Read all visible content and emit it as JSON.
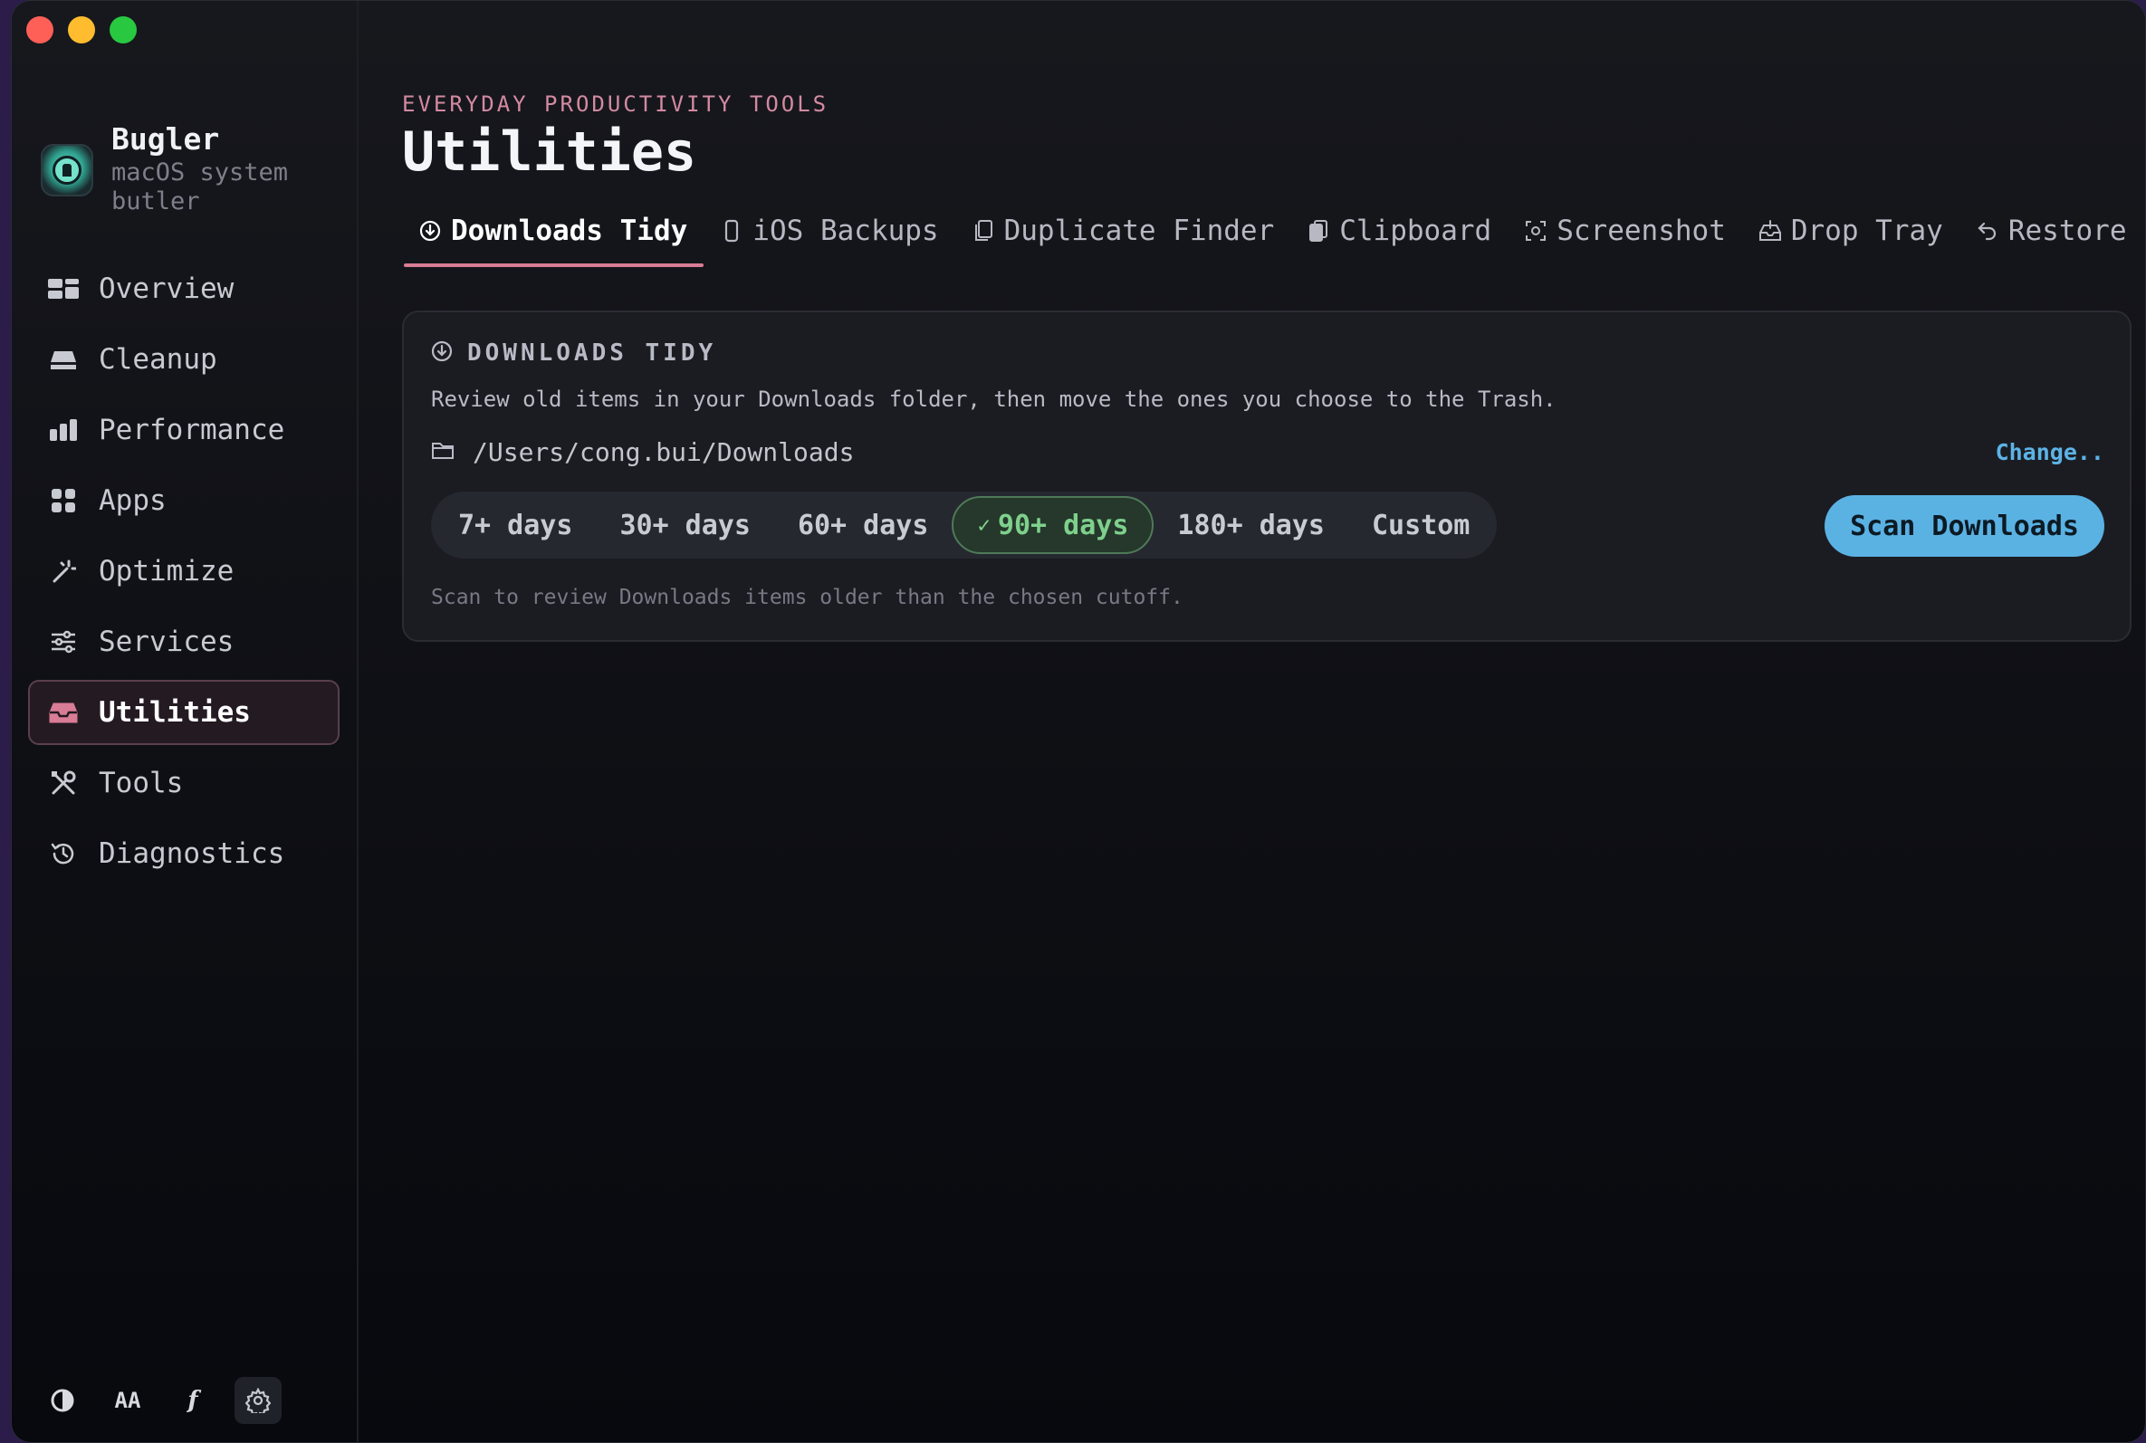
{
  "app": {
    "name": "Bugler",
    "subtitle": "macOS system butler"
  },
  "sidebar": {
    "items": [
      {
        "label": "Overview",
        "icon": "overview-icon",
        "active": false
      },
      {
        "label": "Cleanup",
        "icon": "cleanup-icon",
        "active": false
      },
      {
        "label": "Performance",
        "icon": "performance-icon",
        "active": false
      },
      {
        "label": "Apps",
        "icon": "apps-icon",
        "active": false
      },
      {
        "label": "Optimize",
        "icon": "optimize-icon",
        "active": false
      },
      {
        "label": "Services",
        "icon": "services-icon",
        "active": false
      },
      {
        "label": "Utilities",
        "icon": "utilities-icon",
        "active": true
      },
      {
        "label": "Tools",
        "icon": "tools-icon",
        "active": false
      },
      {
        "label": "Diagnostics",
        "icon": "diagnostics-icon",
        "active": false
      }
    ],
    "bottom": {
      "theme_icon": "contrast-icon",
      "font_size_label": "AA",
      "font_label": "f",
      "settings_icon": "gear-icon"
    }
  },
  "header": {
    "eyebrow": "EVERYDAY PRODUCTIVITY TOOLS",
    "title": "Utilities"
  },
  "tabs": [
    {
      "label": "Downloads Tidy",
      "icon": "download-circle-icon",
      "active": true
    },
    {
      "label": "iOS Backups",
      "icon": "phone-icon",
      "active": false
    },
    {
      "label": "Duplicate Finder",
      "icon": "duplicate-icon",
      "active": false
    },
    {
      "label": "Clipboard",
      "icon": "clipboard-icon",
      "active": false
    },
    {
      "label": "Screenshot",
      "icon": "screenshot-icon",
      "active": false
    },
    {
      "label": "Drop Tray",
      "icon": "tray-icon",
      "active": false
    },
    {
      "label": "Restore Center",
      "icon": "undo-icon",
      "active": false
    }
  ],
  "card": {
    "title": "DOWNLOADS TIDY",
    "description": "Review old items in your Downloads folder, then move the ones you choose to the Trash.",
    "path": "/Users/cong.bui/Downloads",
    "change_label": "Change..",
    "age_options": [
      "7+ days",
      "30+ days",
      "60+ days",
      "90+ days",
      "180+ days",
      "Custom"
    ],
    "selected_option": "90+ days",
    "selected_check": "✓",
    "scan_button": "Scan Downloads",
    "hint": "Scan to review Downloads items older than the chosen cutoff."
  },
  "colors": {
    "accent_pink": "#d97c95",
    "selected_green": "#7ed08c",
    "button_blue": "#5ab2e3"
  }
}
